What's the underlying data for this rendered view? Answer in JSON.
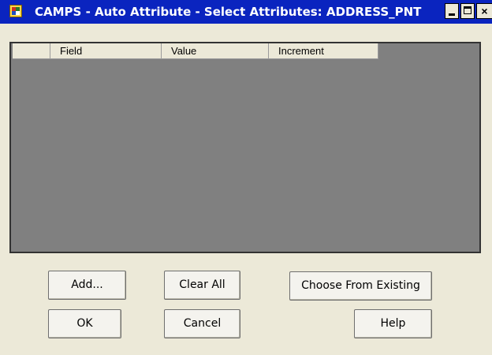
{
  "window": {
    "title": "CAMPS - Auto Attribute - Select Attributes: ADDRESS_PNT",
    "icon": "camps-app-icon",
    "controls": {
      "minimize": "minimize-icon",
      "maximize": "maximize-icon",
      "close_label": "×"
    }
  },
  "list": {
    "columns": [
      "",
      "Field",
      "Value",
      "Increment"
    ],
    "rows": []
  },
  "buttons": {
    "add": "Add...",
    "clear_all": "Clear All",
    "choose_from_existing": "Choose From Existing",
    "ok": "OK",
    "cancel": "Cancel",
    "help": "Help"
  },
  "colors": {
    "titlebar": "#0a24bf",
    "list_background": "#808080",
    "dialog_background": "#ece9d8"
  }
}
